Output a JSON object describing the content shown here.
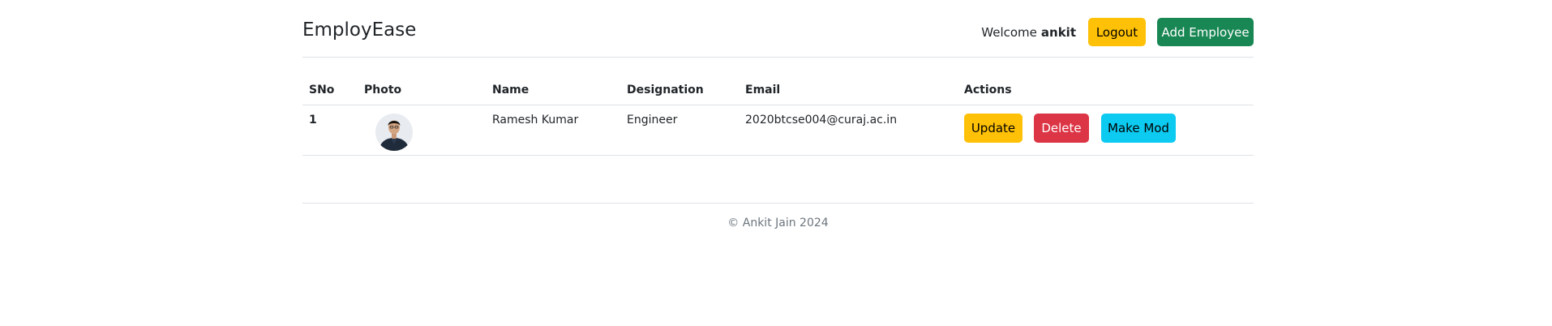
{
  "header": {
    "brand": "EmployEase",
    "welcome_label": "Welcome",
    "username": "ankit",
    "logout_label": "Logout",
    "add_employee_label": "Add Employee"
  },
  "table": {
    "columns": [
      "SNo",
      "Photo",
      "Name",
      "Designation",
      "Email",
      "Actions"
    ],
    "rows": [
      {
        "sno": "1",
        "photo_icon": "employee-avatar",
        "name": "Ramesh Kumar",
        "designation": "Engineer",
        "email": "2020btcse004@curaj.ac.in",
        "update_label": "Update",
        "delete_label": "Delete",
        "make_mod_label": "Make Mod"
      }
    ]
  },
  "footer": {
    "copyright": "© Ankit Jain 2024"
  },
  "colors": {
    "warning": "#ffc107",
    "success": "#198754",
    "danger": "#dc3545",
    "info": "#0dcaf0"
  }
}
